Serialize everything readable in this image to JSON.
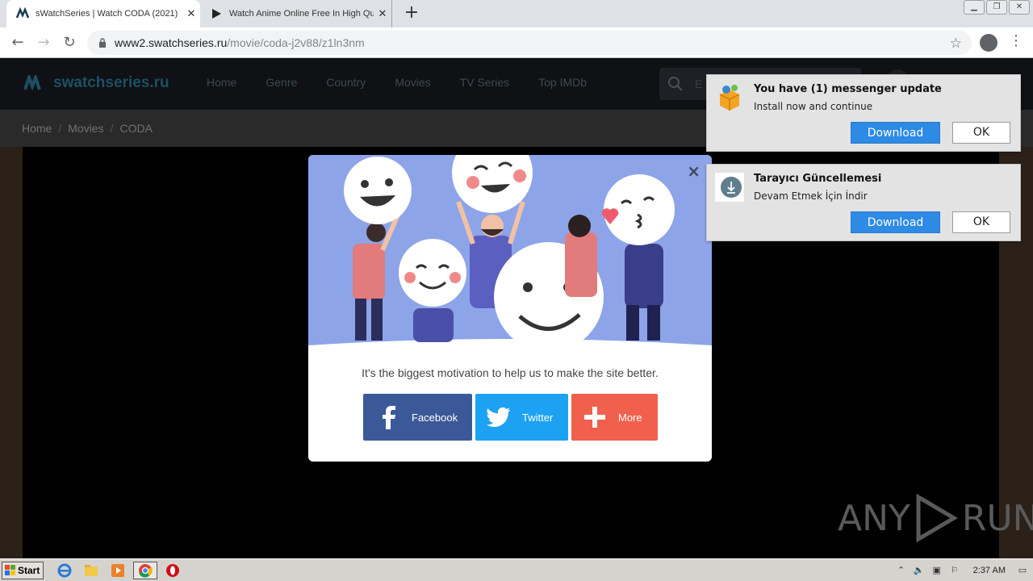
{
  "browser": {
    "tabs": [
      {
        "title": "sWatchSeries | Watch CODA (2021)",
        "active": true
      },
      {
        "title": "Watch Anime Online Free In High Qu",
        "active": false
      }
    ],
    "new_tab": "+",
    "url_host": "www2.swatchseries.ru",
    "url_path": "/movie/coda-j2v88/z1ln3nm",
    "window_controls": [
      "minimize",
      "restore",
      "close"
    ]
  },
  "site": {
    "logo": "swatchseries.ru",
    "menu": [
      "Home",
      "Genre",
      "Country",
      "Movies",
      "TV Series",
      "Top IMDb"
    ],
    "search_placeholder": "E",
    "breadcrumb": [
      "Home",
      "Movies",
      "CODA"
    ],
    "breadcrumb_sep": "/"
  },
  "modal": {
    "close": "×",
    "message": "It's the biggest motivation to help us to make the site better.",
    "buttons": {
      "facebook": "Facebook",
      "twitter": "Twitter",
      "more": "More"
    },
    "colors": {
      "facebook": "#3b5998",
      "twitter": "#1da1f2",
      "more": "#f0604c",
      "art_bg": "#8da4e8"
    }
  },
  "notifications": [
    {
      "title": "You have (1) messenger update",
      "body": "Install now and continue",
      "download": "Download",
      "ok": "OK",
      "icon": "package-icon"
    },
    {
      "title": "Tarayıcı Güncellemesi",
      "body": "Devam Etmek İçin İndir",
      "download": "Download",
      "ok": "OK",
      "icon": "download-circle-icon"
    }
  ],
  "watermark": {
    "left": "ANY",
    "right": "RUN"
  },
  "taskbar": {
    "start": "Start",
    "clock": "2:37 AM",
    "apps": [
      "ie-icon",
      "explorer-icon",
      "media-player-icon",
      "chrome-icon",
      "opera-icon"
    ]
  }
}
